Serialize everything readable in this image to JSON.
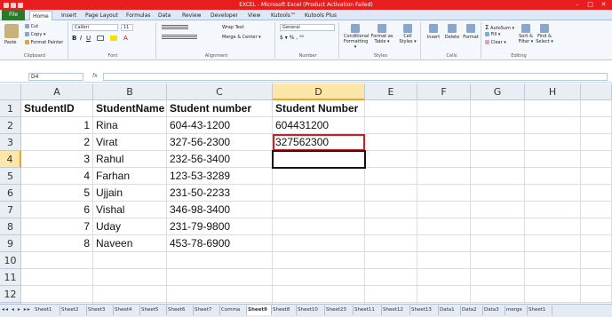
{
  "title": "EXCEL - Microsoft Excel (Product Activation Failed)",
  "tabs": [
    "File",
    "Home",
    "Insert",
    "Page Layout",
    "Formulas",
    "Data",
    "Review",
    "Developer",
    "View",
    "Kutools™",
    "Kutools Plus"
  ],
  "ribbon": {
    "clipboard": {
      "paste": "Paste",
      "cut": "Cut",
      "copy": "Copy ▾",
      "format_painter": "Format Painter",
      "label": "Clipboard"
    },
    "font": {
      "name": "Calibri",
      "size": "11",
      "label": "Font"
    },
    "alignment": {
      "wrap": "Wrap Text",
      "merge": "Merge & Center ▾",
      "label": "Alignment"
    },
    "number": {
      "format": "General",
      "label": "Number"
    },
    "styles": {
      "cond": "Conditional Formatting ▾",
      "table": "Format as Table ▾",
      "cell": "Cell Styles ▾",
      "label": "Styles"
    },
    "cells": {
      "insert": "Insert",
      "delete": "Delete",
      "format": "Format",
      "label": "Cells"
    },
    "editing": {
      "autosum": "AutoSum ▾",
      "fill": "Fill ▾",
      "clear": "Clear ▾",
      "sort": "Sort & Filter ▾",
      "find": "Find & Select ▾",
      "label": "Editing"
    }
  },
  "formula_bar": {
    "name_box": "D4",
    "fx": "fx",
    "value": ""
  },
  "columns": [
    "A",
    "B",
    "C",
    "D",
    "E",
    "F",
    "G",
    "H"
  ],
  "rows": [
    "1",
    "2",
    "3",
    "4",
    "5",
    "6",
    "7",
    "8",
    "9",
    "10",
    "11",
    "12",
    "13"
  ],
  "table": {
    "headers": [
      "StudentID",
      "StudentName",
      "Student number",
      "Student Number"
    ],
    "rows": [
      [
        "1",
        "Rina",
        "604-43-1200",
        "604431200"
      ],
      [
        "2",
        "Virat",
        "327-56-2300",
        "327562300"
      ],
      [
        "3",
        "Rahul",
        "232-56-3400",
        ""
      ],
      [
        "4",
        "Farhan",
        "123-53-3289",
        ""
      ],
      [
        "5",
        "Ujjain",
        "231-50-2233",
        ""
      ],
      [
        "6",
        "Vishal",
        "346-98-3400",
        ""
      ],
      [
        "7",
        "Uday",
        "231-79-9800",
        ""
      ],
      [
        "8",
        "Naveen",
        "453-78-6900",
        ""
      ]
    ]
  },
  "selected_cell": "D4",
  "highlighted_cell": "D3",
  "highlight_color": "#e0161e",
  "sheet_tabs": [
    "Sheet1",
    "Sheet2",
    "Sheet3",
    "Sheet4",
    "Sheet5",
    "Sheet6",
    "Sheet7",
    "Comma",
    "Sheet9",
    "Sheet8",
    "Sheet10",
    "Sheet23",
    "Sheet11",
    "Sheet12",
    "Sheet13",
    "Data1",
    "Data2",
    "Data3",
    "merge",
    "Sheet1"
  ],
  "active_sheet": "Sheet9"
}
